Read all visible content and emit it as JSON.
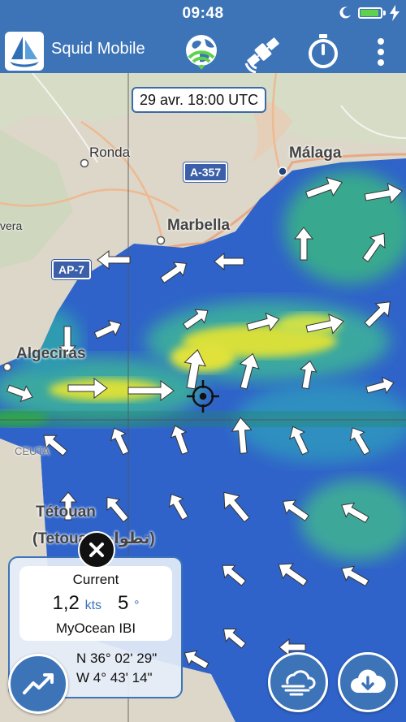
{
  "status_bar": {
    "time": "09:48"
  },
  "header": {
    "app_title": "Squid Mobile",
    "icons": [
      "logo-icon",
      "globe-wifi-icon",
      "satellite-icon",
      "stopwatch-icon",
      "more-vertical-icon"
    ]
  },
  "map": {
    "timestamp": "29 avr. 18:00 UTC",
    "places": {
      "malaga": "Málaga",
      "ronda": "Ronda",
      "marbella": "Marbella",
      "algeciras": "Algeciras",
      "vera": "vera",
      "ceuta": "CEUTA",
      "tetouan": "Tétouan",
      "tetouan_ar": "(Tetouan تطوان)"
    },
    "roads": {
      "a357": "A-357",
      "ap7": "AP-7"
    }
  },
  "info_card": {
    "title": "Current",
    "speed": "1,2",
    "speed_unit": "kts",
    "direction": "5",
    "direction_unit": "°",
    "source": "MyOcean IBI",
    "lat": "N 36° 02' 29\"",
    "lon": "W 4° 43' 14\""
  },
  "buttons": {
    "close": "close-icon",
    "chart": "trend-chart-icon",
    "weather": "wind-cloud-icon",
    "download": "cloud-download-icon"
  },
  "colors": {
    "header": "#3d74b8",
    "ocean_blue": "#2f63c9",
    "current_green": "#38b38a",
    "current_yellow": "#dde23a"
  }
}
